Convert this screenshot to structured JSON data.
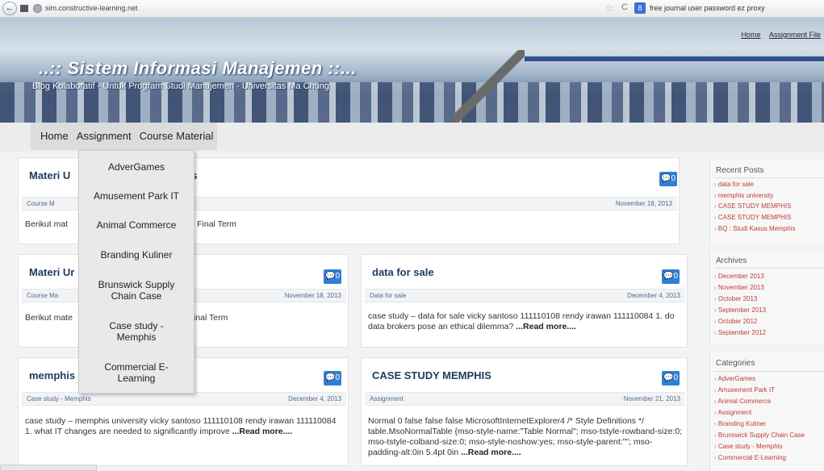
{
  "browser": {
    "url": "sim.constructive-learning.net",
    "search_text": "free journal user password ez proxy",
    "back_glyph": "←",
    "star_glyph": "☆",
    "reload_glyph": "C",
    "google_glyph": "8"
  },
  "header": {
    "title": "..:: Sistem Informasi Manajemen ::...",
    "subtitle": "Blog Kolaboratif - Untuk Program Studi Manajemen - Universitas Ma Chung",
    "links": [
      "Home",
      "Assignment File"
    ]
  },
  "nav": {
    "items": [
      "Home",
      "Assignment",
      "Course Material"
    ]
  },
  "dropdown": {
    "items": [
      "AdverGames",
      "Amusement Park IT",
      "Animal Commerce",
      "Branding Kuliner",
      "Brunswick Supply Chain Case",
      "Case study - Memphis",
      "Commercial E-Learning"
    ]
  },
  "posts": [
    {
      "title": "Materi U",
      "title_tail": "s",
      "comments": "0",
      "category": "Course M",
      "date": "November 18, 2013",
      "excerpt_a": "Berikut mat",
      "excerpt_b": "Final Term"
    },
    {
      "title": "Materi Ur",
      "comments": "0",
      "category": "Course Ma",
      "date": "November 18, 2013",
      "excerpt_a": "Berikut mate",
      "excerpt_b": "inal Term"
    },
    {
      "title": "data for sale",
      "comments": "0",
      "category": "Data for sale",
      "date": "December 4, 2013",
      "excerpt": "case study – data for sale vicky santoso 111110108 rendy irawan 111110084 1. do data brokers pose an ethical dilemma?",
      "read_more": "...Read more...."
    },
    {
      "title": "memphis",
      "comments": "0",
      "category": "Case study - Memphis",
      "date": "December 4, 2013",
      "excerpt": "case study – memphis university vicky santoso 111110108 rendy irawan 111110084 1. what IT changes are needed to significantly improve",
      "read_more": "...Read more...."
    },
    {
      "title": "CASE STUDY MEMPHIS",
      "comments": "0",
      "category": "Assignment",
      "date": "November 21, 2013",
      "excerpt": "Normal 0 false false false MicrosoftInternetExplorer4 /* Style Definitions */ table.MsoNormalTable {mso-style-name:\"Table Normal\"; mso-tstyle-rowband-size:0; mso-tstyle-colband-size:0; mso-style-noshow:yes; mso-style-parent:\"\"; mso-padding-alt:0in 5.4pt 0in",
      "read_more": "...Read more...."
    }
  ],
  "sidebar": {
    "recent": {
      "title": "Recent Posts",
      "items": [
        "data for sale",
        "memphis university",
        "CASE STUDY MEMPHIS",
        "CASE STUDY MEMPHIS",
        "BQ : Studi Kasus Memphis"
      ]
    },
    "archives": {
      "title": "Archives",
      "items": [
        "December 2013",
        "November 2013",
        "October 2013",
        "September 2013",
        "October 2012",
        "September 2012"
      ]
    },
    "categories": {
      "title": "Categories",
      "items": [
        "AdverGames",
        "Amusement Park IT",
        "Animal Commerce",
        "Assignment",
        "Branding Kuliner",
        "Brunswick Supply Chain Case",
        "Case study - Memphis",
        "Commercial E-Learning"
      ]
    }
  }
}
